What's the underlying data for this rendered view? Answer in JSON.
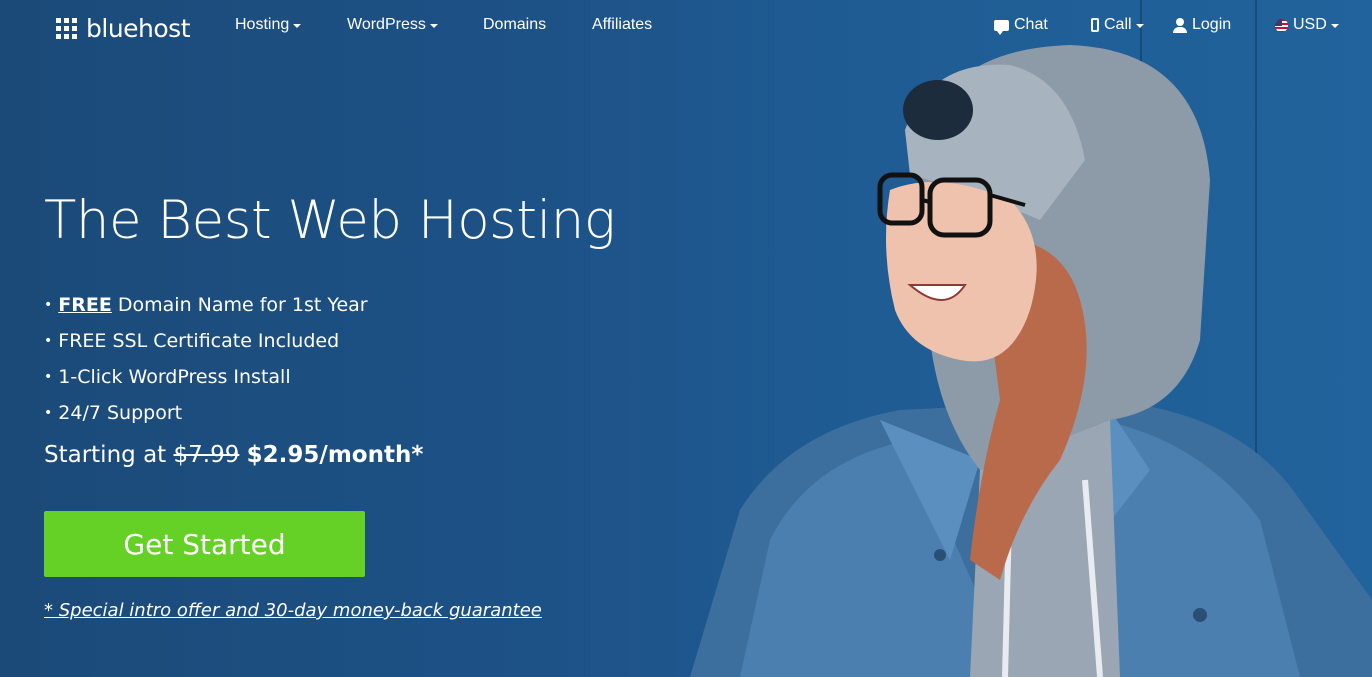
{
  "brand": {
    "name": "bluehost"
  },
  "nav": {
    "left": [
      {
        "label": "Hosting",
        "dropdown": true
      },
      {
        "label": "WordPress",
        "dropdown": true
      },
      {
        "label": "Domains",
        "dropdown": false
      },
      {
        "label": "Affiliates",
        "dropdown": false
      }
    ],
    "right": [
      {
        "label": "Chat",
        "icon": "chat-icon",
        "dropdown": false
      },
      {
        "label": "Call",
        "icon": "phone-icon",
        "dropdown": true
      },
      {
        "label": "Login",
        "icon": "user-icon",
        "dropdown": false
      },
      {
        "label": "USD",
        "icon": "us-flag-icon",
        "dropdown": true
      }
    ]
  },
  "hero": {
    "headline": "The Best Web Hosting",
    "features": [
      {
        "strong": "FREE",
        "text": " Domain Name for 1st Year"
      },
      {
        "strong": "",
        "text": "FREE SSL Certificate Included"
      },
      {
        "strong": "",
        "text": "1-Click WordPress Install"
      },
      {
        "strong": "",
        "text": "24/7 Support"
      }
    ],
    "price_prefix": "Starting at ",
    "old_price": "$7.99",
    "new_price": "$2.95/month*",
    "cta_label": "Get Started",
    "disclaimer": "* Special intro offer and 30-day money-back guarantee"
  },
  "colors": {
    "background": "#1d5287",
    "cta": "#65d026",
    "text": "#ffffff"
  }
}
